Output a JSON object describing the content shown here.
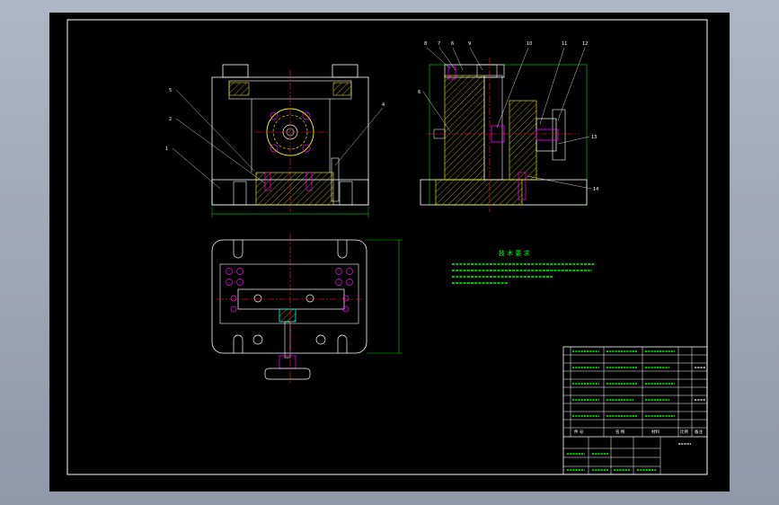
{
  "palette": {
    "background": "#000000",
    "outline": "#ffffff",
    "centerline": "#ff2020",
    "hatch": "#ffff00",
    "part": "#ff00ff",
    "dimension": "#00ff00",
    "leader": "#ffffff",
    "frame_surround": "#9aa2b2"
  },
  "front_view": {
    "balloons": [
      "5",
      "2",
      "1",
      "4"
    ]
  },
  "side_view": {
    "balloons_top": [
      "8",
      "7",
      "6",
      "9",
      "10",
      "11",
      "12"
    ],
    "balloons_side": [
      "6",
      "13",
      "14"
    ]
  },
  "technical_requirements": {
    "title": "技 术 要 求"
  },
  "title_block": {
    "labels": {
      "col_a": "件 号",
      "col_b": "名 称",
      "col_c": "材料",
      "col_d": "比例",
      "col_e": "备注"
    }
  }
}
